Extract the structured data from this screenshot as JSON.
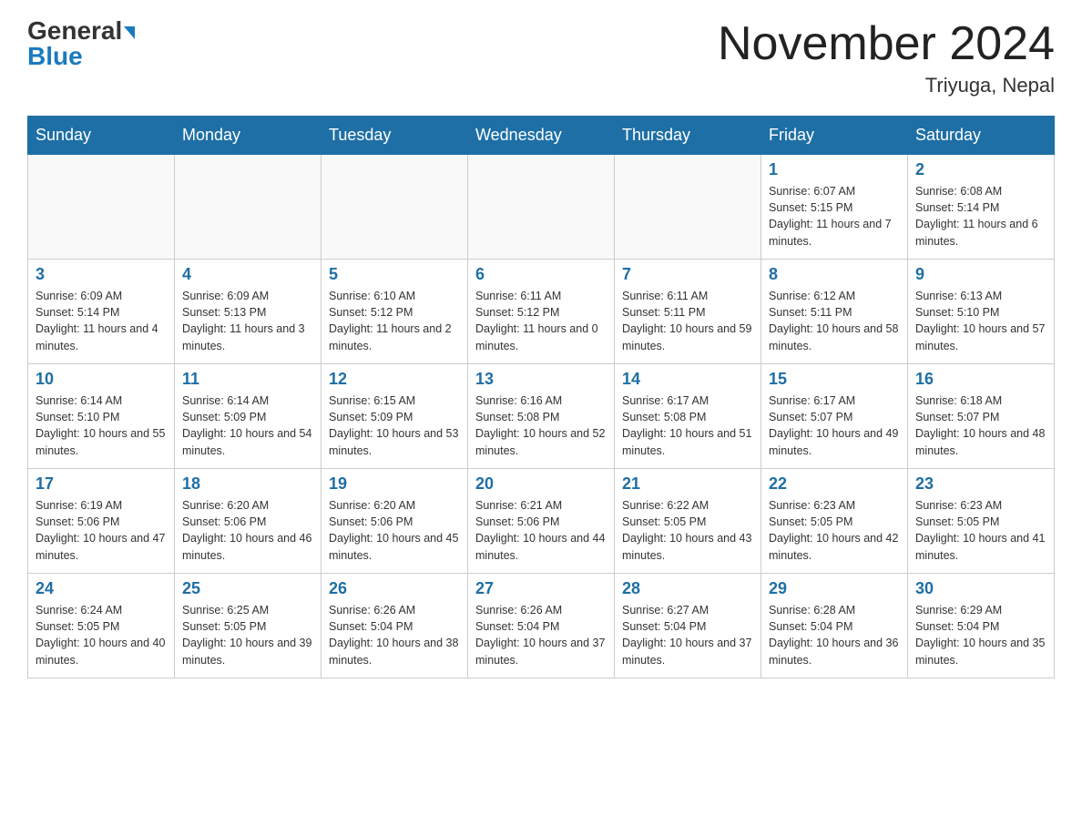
{
  "header": {
    "logo_general": "General",
    "logo_blue": "Blue",
    "title": "November 2024",
    "location": "Triyuga, Nepal"
  },
  "days_of_week": [
    "Sunday",
    "Monday",
    "Tuesday",
    "Wednesday",
    "Thursday",
    "Friday",
    "Saturday"
  ],
  "weeks": [
    [
      {
        "day": "",
        "info": ""
      },
      {
        "day": "",
        "info": ""
      },
      {
        "day": "",
        "info": ""
      },
      {
        "day": "",
        "info": ""
      },
      {
        "day": "",
        "info": ""
      },
      {
        "day": "1",
        "info": "Sunrise: 6:07 AM\nSunset: 5:15 PM\nDaylight: 11 hours and 7 minutes."
      },
      {
        "day": "2",
        "info": "Sunrise: 6:08 AM\nSunset: 5:14 PM\nDaylight: 11 hours and 6 minutes."
      }
    ],
    [
      {
        "day": "3",
        "info": "Sunrise: 6:09 AM\nSunset: 5:14 PM\nDaylight: 11 hours and 4 minutes."
      },
      {
        "day": "4",
        "info": "Sunrise: 6:09 AM\nSunset: 5:13 PM\nDaylight: 11 hours and 3 minutes."
      },
      {
        "day": "5",
        "info": "Sunrise: 6:10 AM\nSunset: 5:12 PM\nDaylight: 11 hours and 2 minutes."
      },
      {
        "day": "6",
        "info": "Sunrise: 6:11 AM\nSunset: 5:12 PM\nDaylight: 11 hours and 0 minutes."
      },
      {
        "day": "7",
        "info": "Sunrise: 6:11 AM\nSunset: 5:11 PM\nDaylight: 10 hours and 59 minutes."
      },
      {
        "day": "8",
        "info": "Sunrise: 6:12 AM\nSunset: 5:11 PM\nDaylight: 10 hours and 58 minutes."
      },
      {
        "day": "9",
        "info": "Sunrise: 6:13 AM\nSunset: 5:10 PM\nDaylight: 10 hours and 57 minutes."
      }
    ],
    [
      {
        "day": "10",
        "info": "Sunrise: 6:14 AM\nSunset: 5:10 PM\nDaylight: 10 hours and 55 minutes."
      },
      {
        "day": "11",
        "info": "Sunrise: 6:14 AM\nSunset: 5:09 PM\nDaylight: 10 hours and 54 minutes."
      },
      {
        "day": "12",
        "info": "Sunrise: 6:15 AM\nSunset: 5:09 PM\nDaylight: 10 hours and 53 minutes."
      },
      {
        "day": "13",
        "info": "Sunrise: 6:16 AM\nSunset: 5:08 PM\nDaylight: 10 hours and 52 minutes."
      },
      {
        "day": "14",
        "info": "Sunrise: 6:17 AM\nSunset: 5:08 PM\nDaylight: 10 hours and 51 minutes."
      },
      {
        "day": "15",
        "info": "Sunrise: 6:17 AM\nSunset: 5:07 PM\nDaylight: 10 hours and 49 minutes."
      },
      {
        "day": "16",
        "info": "Sunrise: 6:18 AM\nSunset: 5:07 PM\nDaylight: 10 hours and 48 minutes."
      }
    ],
    [
      {
        "day": "17",
        "info": "Sunrise: 6:19 AM\nSunset: 5:06 PM\nDaylight: 10 hours and 47 minutes."
      },
      {
        "day": "18",
        "info": "Sunrise: 6:20 AM\nSunset: 5:06 PM\nDaylight: 10 hours and 46 minutes."
      },
      {
        "day": "19",
        "info": "Sunrise: 6:20 AM\nSunset: 5:06 PM\nDaylight: 10 hours and 45 minutes."
      },
      {
        "day": "20",
        "info": "Sunrise: 6:21 AM\nSunset: 5:06 PM\nDaylight: 10 hours and 44 minutes."
      },
      {
        "day": "21",
        "info": "Sunrise: 6:22 AM\nSunset: 5:05 PM\nDaylight: 10 hours and 43 minutes."
      },
      {
        "day": "22",
        "info": "Sunrise: 6:23 AM\nSunset: 5:05 PM\nDaylight: 10 hours and 42 minutes."
      },
      {
        "day": "23",
        "info": "Sunrise: 6:23 AM\nSunset: 5:05 PM\nDaylight: 10 hours and 41 minutes."
      }
    ],
    [
      {
        "day": "24",
        "info": "Sunrise: 6:24 AM\nSunset: 5:05 PM\nDaylight: 10 hours and 40 minutes."
      },
      {
        "day": "25",
        "info": "Sunrise: 6:25 AM\nSunset: 5:05 PM\nDaylight: 10 hours and 39 minutes."
      },
      {
        "day": "26",
        "info": "Sunrise: 6:26 AM\nSunset: 5:04 PM\nDaylight: 10 hours and 38 minutes."
      },
      {
        "day": "27",
        "info": "Sunrise: 6:26 AM\nSunset: 5:04 PM\nDaylight: 10 hours and 37 minutes."
      },
      {
        "day": "28",
        "info": "Sunrise: 6:27 AM\nSunset: 5:04 PM\nDaylight: 10 hours and 37 minutes."
      },
      {
        "day": "29",
        "info": "Sunrise: 6:28 AM\nSunset: 5:04 PM\nDaylight: 10 hours and 36 minutes."
      },
      {
        "day": "30",
        "info": "Sunrise: 6:29 AM\nSunset: 5:04 PM\nDaylight: 10 hours and 35 minutes."
      }
    ]
  ]
}
